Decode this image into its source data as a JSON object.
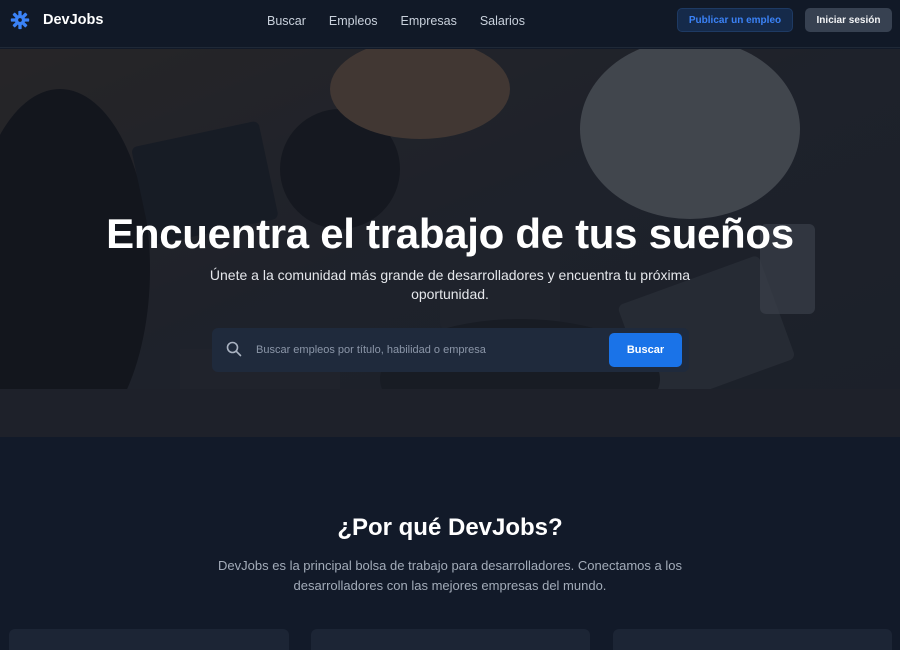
{
  "header": {
    "brand_name": "DevJobs",
    "logo_icon": "gear-icon",
    "nav": [
      "Buscar",
      "Empleos",
      "Empresas",
      "Salarios"
    ],
    "post_job_label": "Publicar un empleo",
    "login_label": "Iniciar sesión"
  },
  "hero": {
    "title": "Encuentra el trabajo de tus sueños",
    "subtitle": "Únete a la comunidad más grande de desarrolladores y encuentra tu próxima oportunidad.",
    "search": {
      "placeholder": "Buscar empleos por título, habilidad o empresa",
      "value": "",
      "button_label": "Buscar",
      "icon": "search-icon"
    }
  },
  "why": {
    "title": "¿Por qué DevJobs?",
    "text": "DevJobs es la principal bolsa de trabajo para desarrolladores. Conectamos a los desarrolladores con las mejores empresas del mundo."
  },
  "colors": {
    "accent": "#1a73e8",
    "page_bg": "#121a29",
    "header_bg": "#111927",
    "logo": "#3b82f6"
  }
}
